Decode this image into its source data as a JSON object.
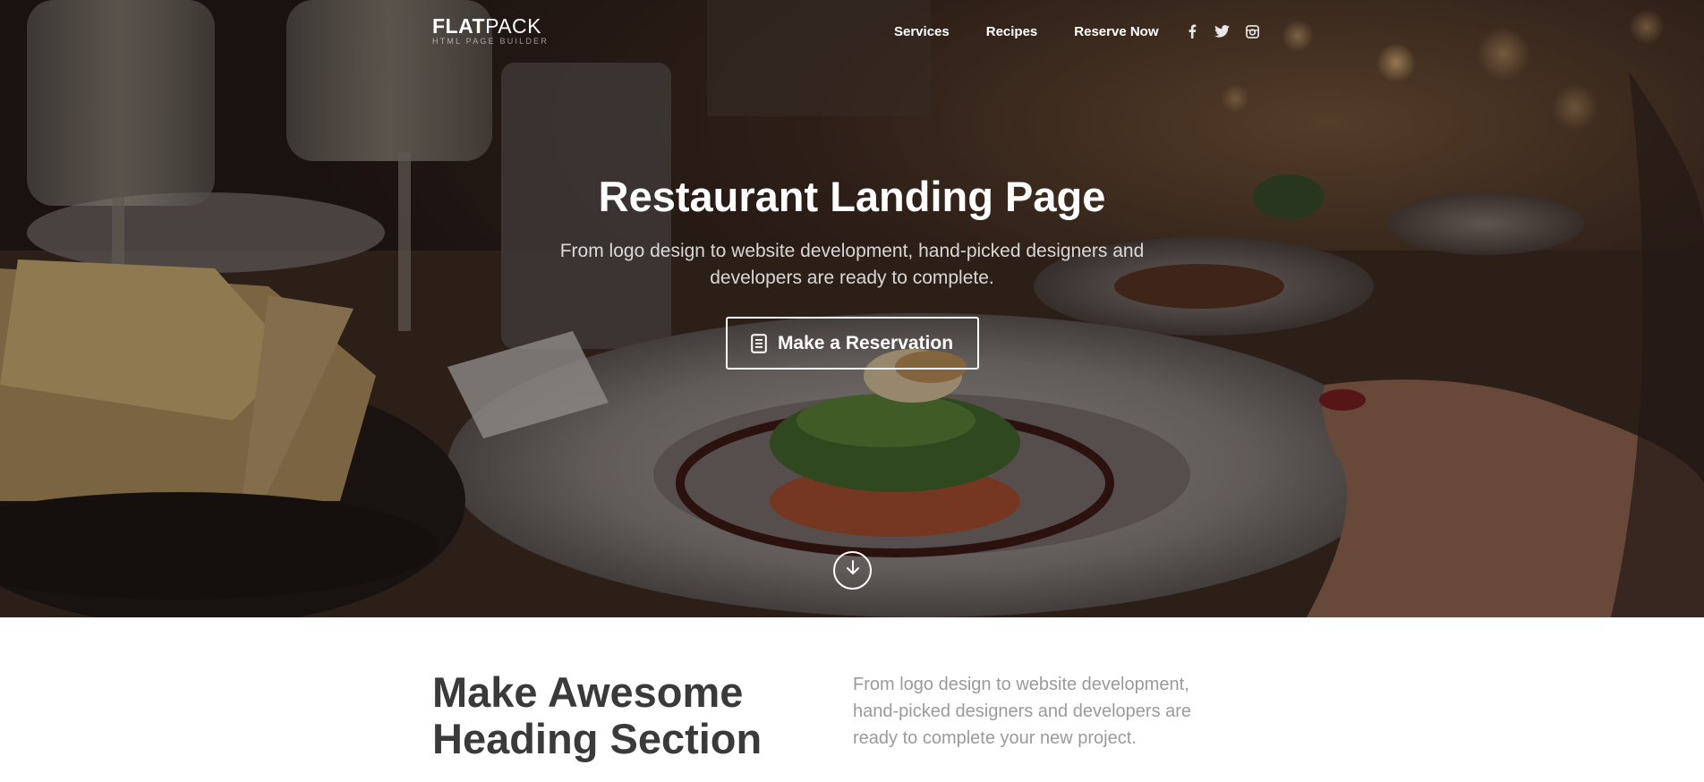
{
  "brand": {
    "name_bold": "FLAT",
    "name_light": "PACK",
    "tagline": "HTML PAGE BUILDER"
  },
  "nav": {
    "links": [
      "Services",
      "Recipes",
      "Reserve Now"
    ],
    "social": [
      "facebook-icon",
      "twitter-icon",
      "instagram-icon"
    ]
  },
  "hero": {
    "title": "Restaurant Landing Page",
    "subtitle": "From logo design to website development, hand-picked designers and developers are ready to complete.",
    "cta_label": "Make a Reservation",
    "cta_icon": "document-icon",
    "scroll_icon": "arrow-down-circle-icon"
  },
  "section": {
    "heading": "Make Awesome Heading Section",
    "text": "From logo design to website development, hand-picked designers and developers are ready to complete your new project."
  },
  "colors": {
    "heading": "#3a3a3a",
    "muted_text": "#9a9a9a",
    "hero_text": "#ffffff"
  }
}
